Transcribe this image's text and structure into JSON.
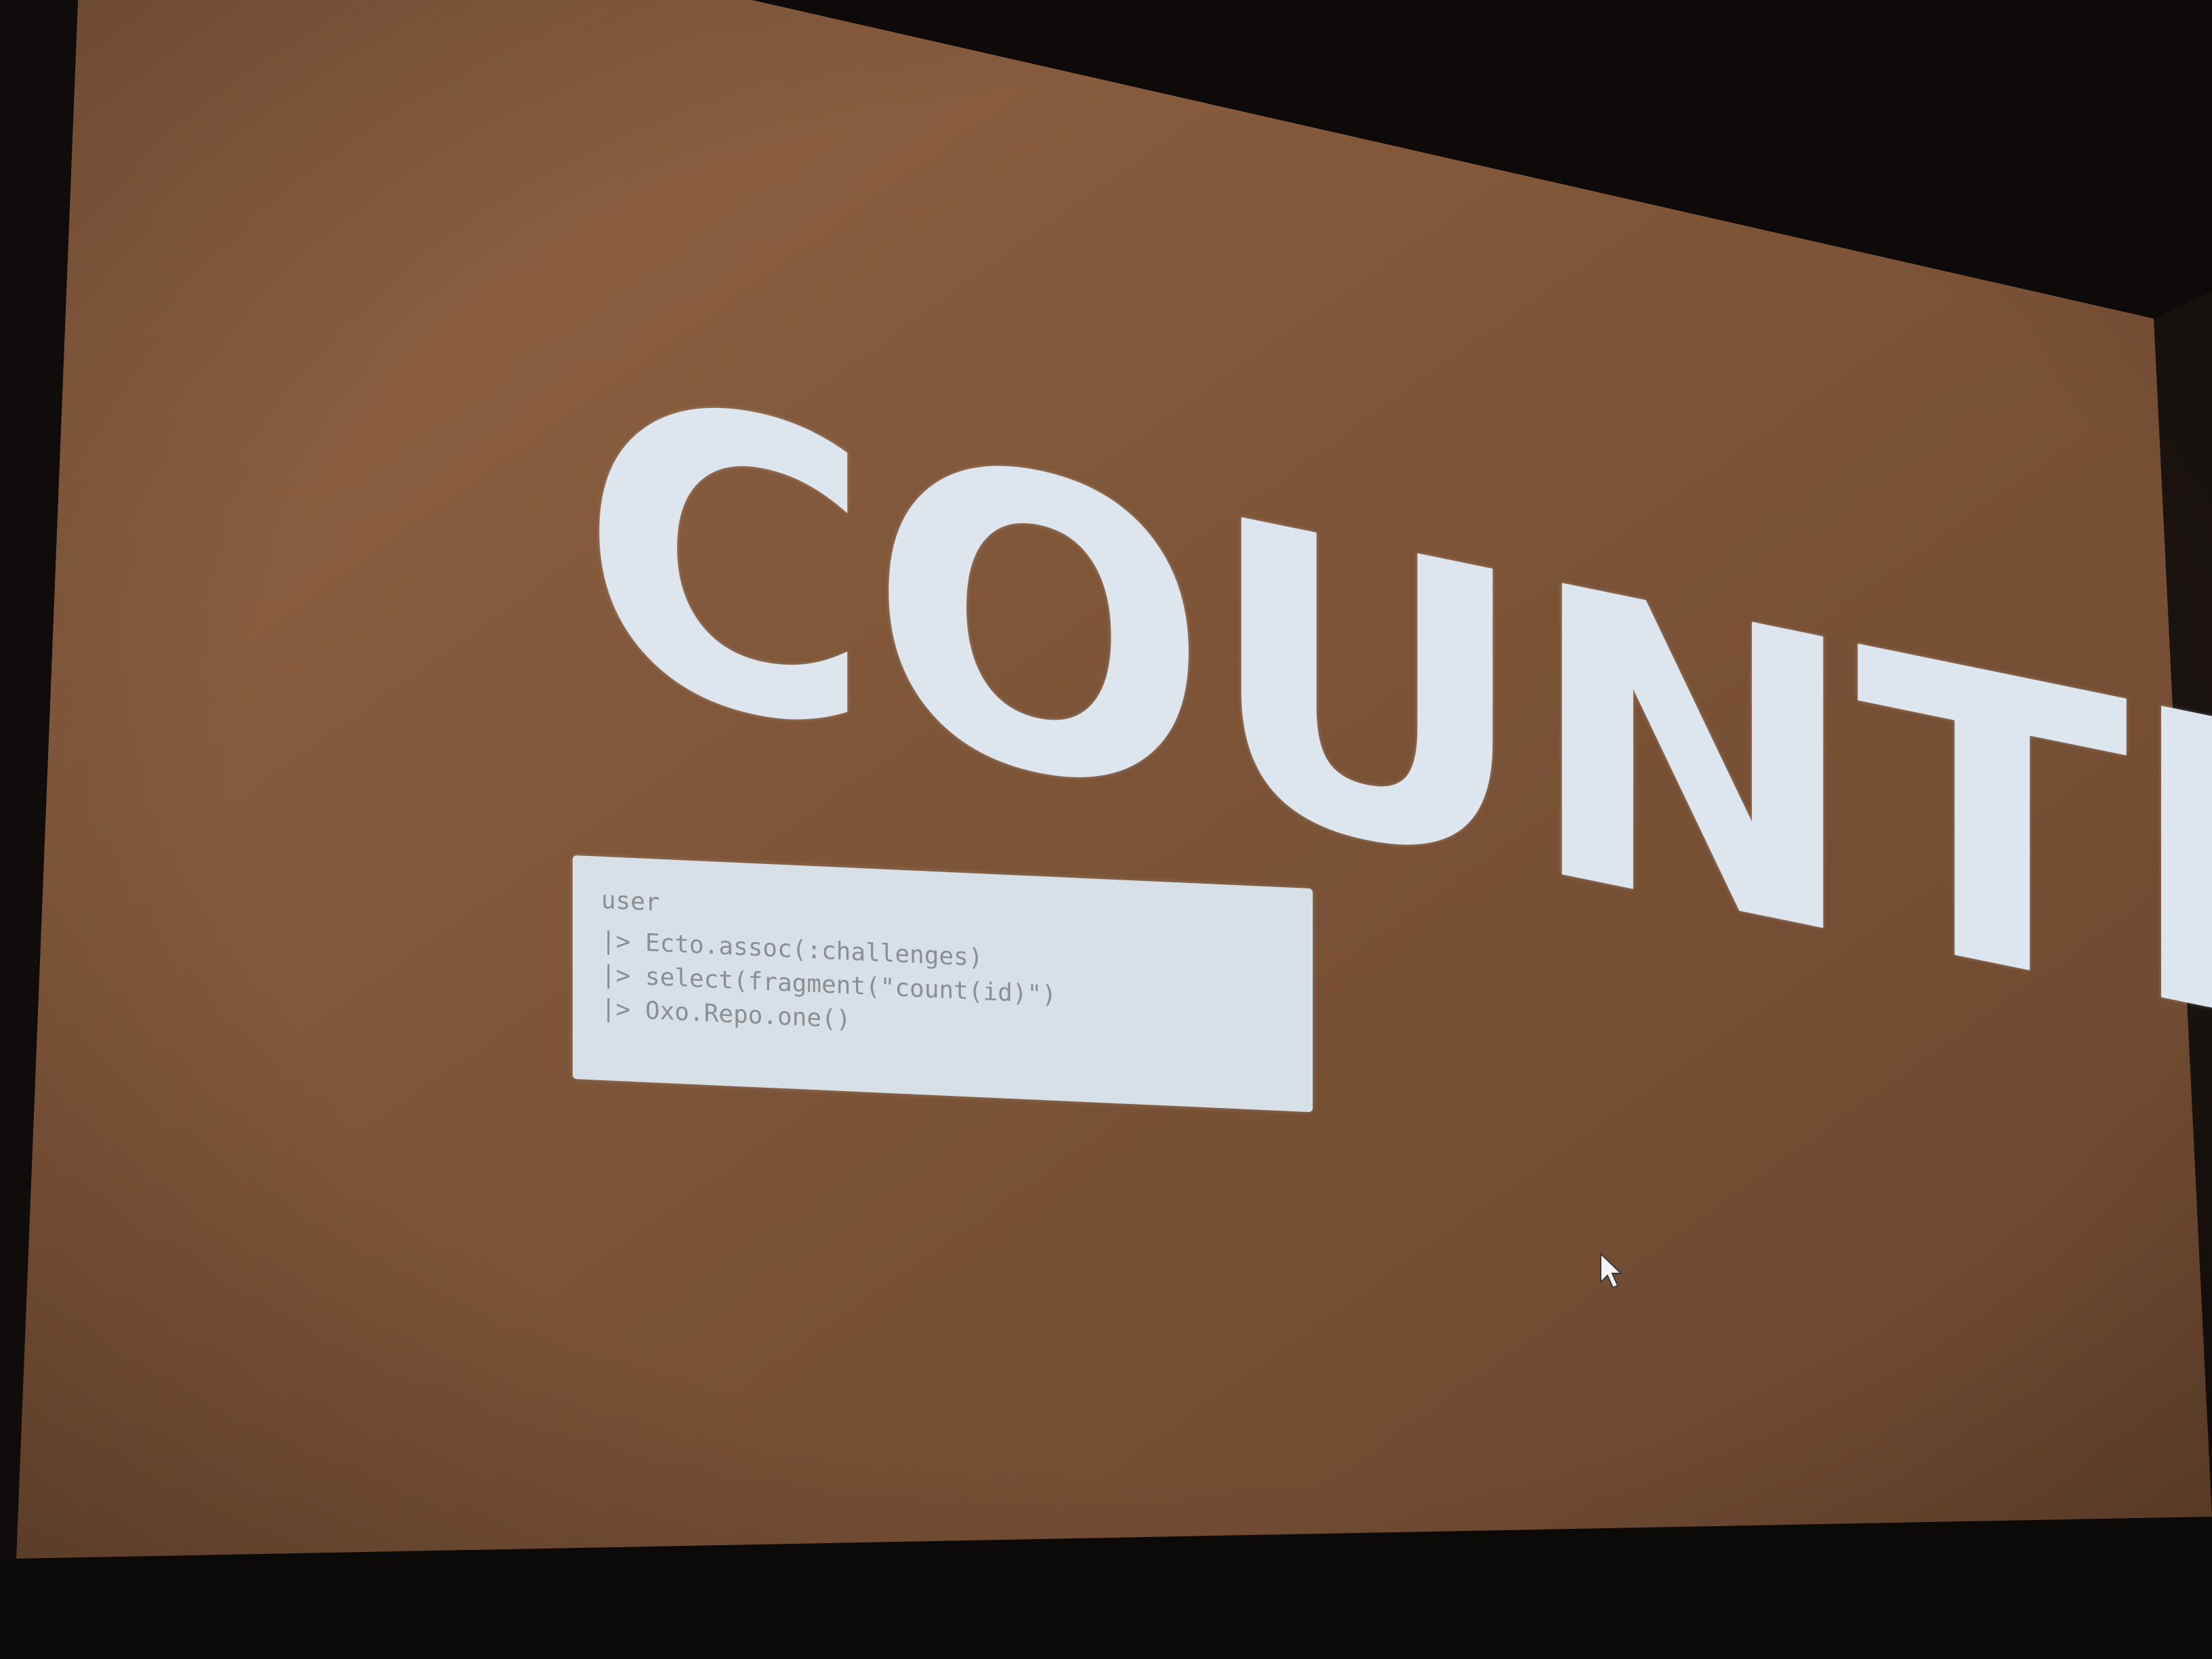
{
  "slide": {
    "title": "COUNTING",
    "code_lines": [
      "user",
      "|> Ecto.assoc(:challenges)",
      "|> select(fragment(\"count(id)\")",
      "|> Oxo.Repo.one()"
    ]
  },
  "colors": {
    "slide_background": "#7a5236",
    "title_text": "#dde6ee",
    "code_background": "#d6e0e6",
    "code_text": "#8c8f92",
    "room_dark": "#120d0b"
  },
  "icons": {
    "mouse_cursor": "mouse-pointer-icon"
  }
}
